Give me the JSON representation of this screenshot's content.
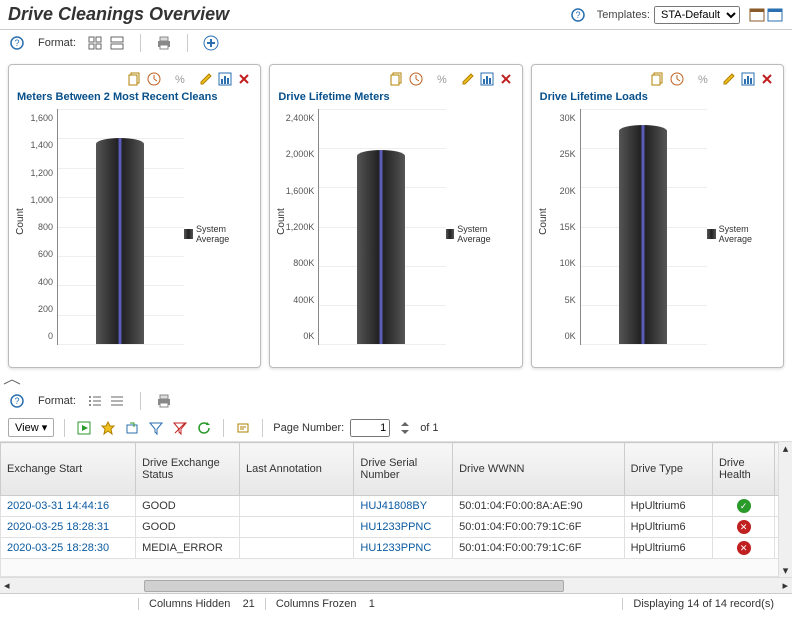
{
  "header": {
    "title": "Drive Cleanings Overview",
    "templates_label": "Templates:",
    "template_selected": "STA-Default"
  },
  "format_label": "Format:",
  "panel_actions": [
    "copy",
    "clock",
    "percent",
    "pencil",
    "chart",
    "close"
  ],
  "charts_legend": "System Average",
  "y_axis_label": "Count",
  "chart_data": [
    {
      "title": "Meters Between 2 Most Recent Cleans",
      "type": "bar",
      "categories": [
        "System Average"
      ],
      "values": [
        1400
      ],
      "ylim": [
        0,
        1600
      ],
      "yticks": [
        "1,600",
        "1,400",
        "1,200",
        "1,000",
        "800",
        "600",
        "400",
        "200",
        "0"
      ]
    },
    {
      "title": "Drive Lifetime Meters",
      "type": "bar",
      "categories": [
        "System Average"
      ],
      "values": [
        1980000
      ],
      "ylim": [
        0,
        2400000
      ],
      "yticks": [
        "2,400K",
        "2,000K",
        "1,600K",
        "1,200K",
        "800K",
        "400K",
        "0K"
      ]
    },
    {
      "title": "Drive Lifetime Loads",
      "type": "bar",
      "categories": [
        "System Average"
      ],
      "values": [
        28000
      ],
      "ylim": [
        0,
        30000
      ],
      "yticks": [
        "30K",
        "25K",
        "20K",
        "15K",
        "10K",
        "5K",
        "0K"
      ]
    }
  ],
  "table_toolbar": {
    "view_label": "View",
    "page_label": "Page Number:",
    "page_value": "1",
    "page_total": "of 1"
  },
  "columns": [
    "Exchange Start",
    "Drive Exchange Status",
    "Last Annotation",
    "Drive Serial Number",
    "Drive WWNN",
    "Drive Type",
    "Drive Health"
  ],
  "rows": [
    {
      "start": "2020-03-31 14:44:16",
      "status": "GOOD",
      "annot": "",
      "serial": "HUJ41808BY",
      "wwnn": "50:01:04:F0:00:8A:AE:90",
      "type": "HpUltrium6",
      "health": "ok"
    },
    {
      "start": "2020-03-25 18:28:31",
      "status": "GOOD",
      "annot": "",
      "serial": "HU1233PPNC",
      "wwnn": "50:01:04:F0:00:79:1C:6F",
      "type": "HpUltrium6",
      "health": "bad"
    },
    {
      "start": "2020-03-25 18:28:30",
      "status": "MEDIA_ERROR",
      "annot": "",
      "serial": "HU1233PPNC",
      "wwnn": "50:01:04:F0:00:79:1C:6F",
      "type": "HpUltrium6",
      "health": "bad"
    }
  ],
  "footer": {
    "cols_hidden_label": "Columns Hidden",
    "cols_hidden": "21",
    "cols_frozen_label": "Columns Frozen",
    "cols_frozen": "1",
    "records": "Displaying 14 of 14 record(s)"
  }
}
